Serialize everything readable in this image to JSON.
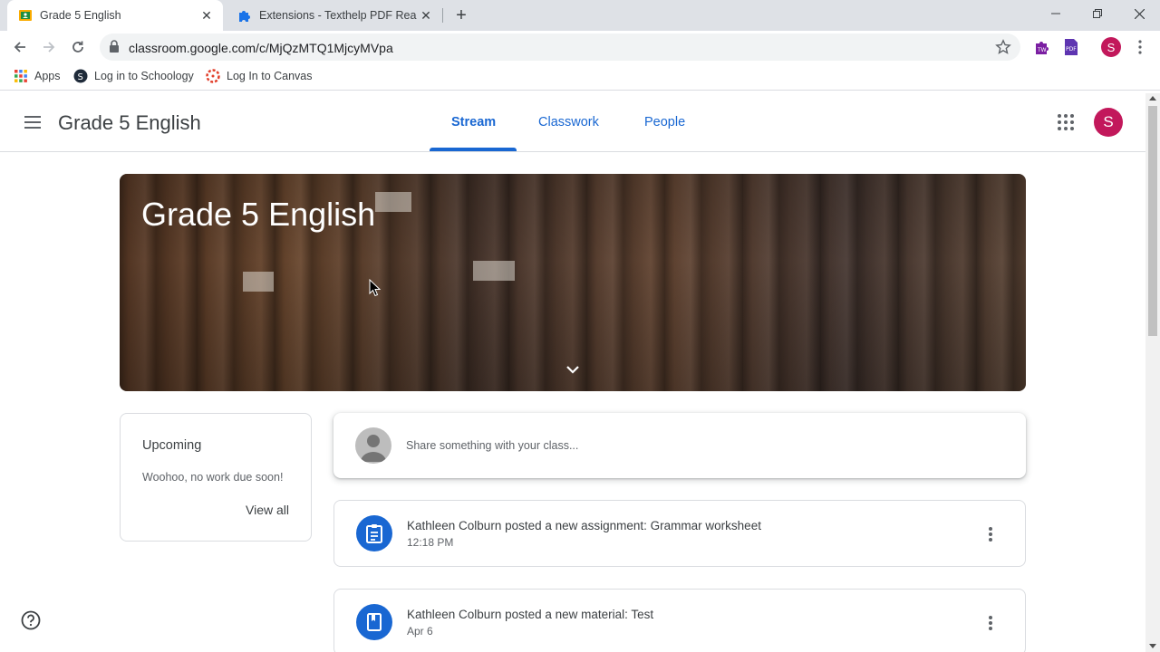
{
  "browser": {
    "tabs": [
      {
        "title": "Grade 5 English",
        "icon": "classroom-favicon",
        "active": true
      },
      {
        "title": "Extensions - Texthelp PDF Reader",
        "icon": "extension-puzzle-icon",
        "active": false
      }
    ],
    "url": "classroom.google.com/c/MjQzMTQ1MjcyMVpa",
    "profile_initial": "S",
    "bookmarks": [
      {
        "label": "Apps",
        "icon": "apps-grid-icon"
      },
      {
        "label": "Log in to Schoology",
        "icon": "schoology-icon"
      },
      {
        "label": "Log In to Canvas",
        "icon": "canvas-icon"
      }
    ]
  },
  "header": {
    "class_title": "Grade 5 English",
    "tabs": [
      {
        "label": "Stream",
        "active": true
      },
      {
        "label": "Classwork",
        "active": false
      },
      {
        "label": "People",
        "active": false
      }
    ],
    "avatar_initial": "S"
  },
  "banner": {
    "title": "Grade 5 English"
  },
  "upcoming": {
    "title": "Upcoming",
    "text": "Woohoo, no work due soon!",
    "link": "View all"
  },
  "share": {
    "placeholder": "Share something with your class..."
  },
  "posts": [
    {
      "title": "Kathleen Colburn posted a new assignment: Grammar worksheet",
      "date": "12:18 PM",
      "icon": "assignment-icon"
    },
    {
      "title": "Kathleen Colburn posted a new material: Test",
      "date": "Apr 6",
      "icon": "material-book-icon"
    }
  ],
  "colors": {
    "accent": "#1967d2",
    "avatar": "#c2185b"
  }
}
